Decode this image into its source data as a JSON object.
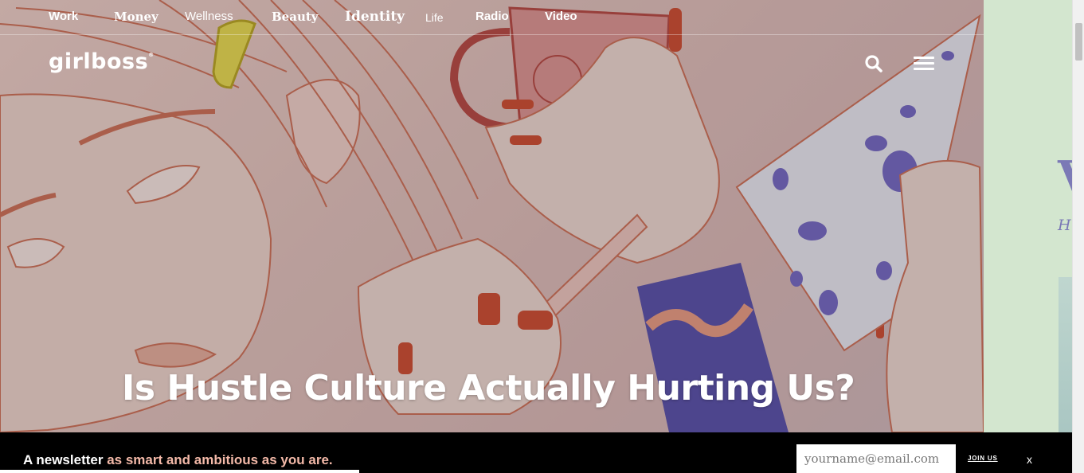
{
  "nav": {
    "items": [
      {
        "label": "Work"
      },
      {
        "label": "Money"
      },
      {
        "label": "Wellness"
      },
      {
        "label": "Beauty"
      },
      {
        "label": "Identity"
      },
      {
        "label": "Life"
      },
      {
        "label": "Radio"
      },
      {
        "label": "Video"
      }
    ]
  },
  "brand": {
    "logo_text": "girlboss",
    "registered_mark": "®"
  },
  "header_icons": {
    "search": "search-icon",
    "menu": "hamburger-menu-icon"
  },
  "hero": {
    "headline": "Is Hustle Culture Actually Hurting Us?"
  },
  "side_panel": {
    "big_text": "V",
    "small_text": "H"
  },
  "newsletter": {
    "message_plain": "A newsletter ",
    "message_accent": "as smart and ambitious as you are.",
    "email_placeholder": "yourname@email.com",
    "email_value": "",
    "join_label": "JOIN US",
    "close_label": "x"
  },
  "colors": {
    "newsletter_bg": "#000000",
    "accent_text": "#f3b9a8",
    "side_panel_bg": "#d3e6cf",
    "side_panel_text": "#7b79b6"
  }
}
